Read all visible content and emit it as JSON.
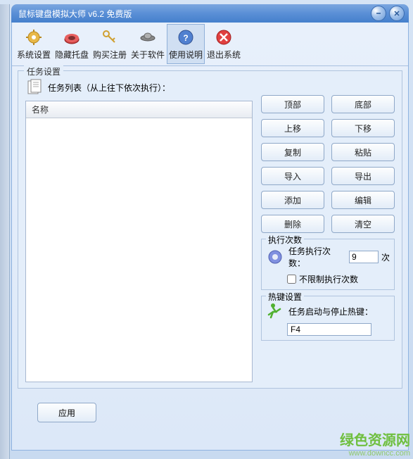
{
  "window": {
    "title": "鼠标键盘模拟大师 v6.2 免费版"
  },
  "toolbar": {
    "items": [
      {
        "label": "系统设置"
      },
      {
        "label": "隐藏托盘"
      },
      {
        "label": "购买注册"
      },
      {
        "label": "关于软件"
      },
      {
        "label": "使用说明"
      },
      {
        "label": "退出系统"
      }
    ]
  },
  "task_group": {
    "title": "任务设置",
    "list_header_label": "任务列表（从上往下依次执行）：",
    "column_name": "名称"
  },
  "buttons": {
    "top": "顶部",
    "bottom": "底部",
    "up": "上移",
    "down": "下移",
    "copy": "复制",
    "paste": "粘贴",
    "import": "导入",
    "export": "导出",
    "add": "添加",
    "edit": "编辑",
    "delete": "删除",
    "clear": "清空"
  },
  "exec": {
    "title": "执行次数",
    "count_label": "任务执行次数：",
    "count_value": "9",
    "count_suffix": "次",
    "unlimited_label": "不限制执行次数",
    "unlimited_checked": false
  },
  "hotkey": {
    "title": "热键设置",
    "label": "任务启动与停止热键：",
    "value": "F4"
  },
  "apply_label": "应用",
  "watermark": {
    "line1": "绿色资源网",
    "line2": "www.downcc.com"
  }
}
